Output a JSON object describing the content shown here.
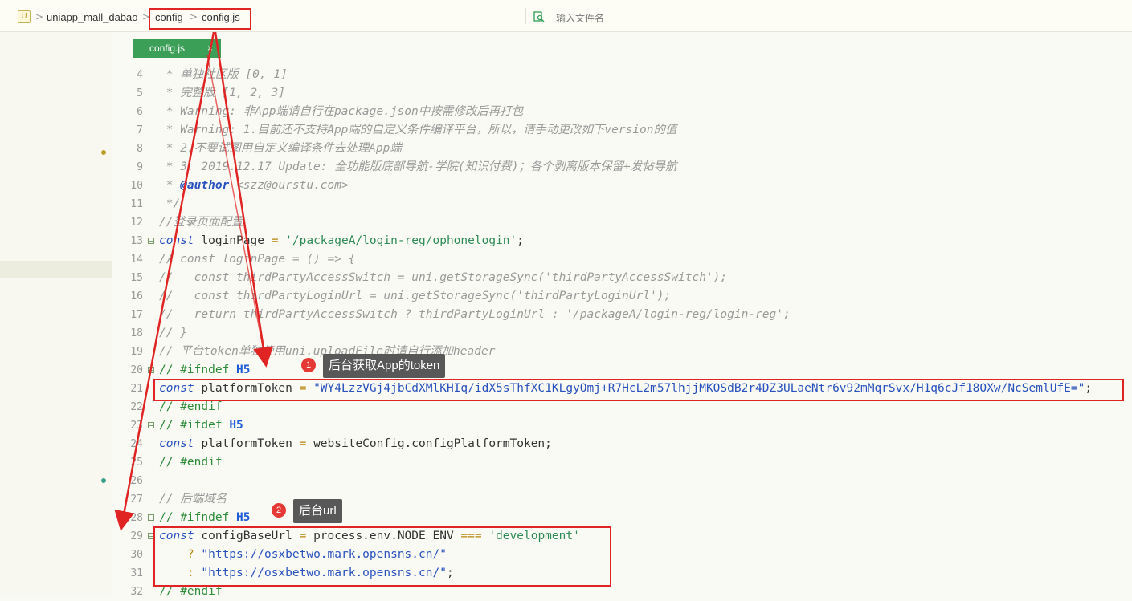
{
  "breadcrumb": {
    "logo": "U",
    "project": "uniapp_mall_dabao",
    "folder": "config",
    "file": "config.js",
    "separator": ">"
  },
  "find": {
    "placeholder": "输入文件名"
  },
  "tab": {
    "label": "config.js",
    "close": "×"
  },
  "lines": [
    {
      "n": "4",
      "parts": [
        {
          "c": "cm",
          "t": " * 单独社区版 [0, 1]"
        }
      ]
    },
    {
      "n": "5",
      "parts": [
        {
          "c": "cm",
          "t": " * 完整版 [1, 2, 3]"
        }
      ]
    },
    {
      "n": "6",
      "parts": [
        {
          "c": "cm",
          "t": " * Warning: 非App端请自行在package.json中按需修改后再打包"
        }
      ]
    },
    {
      "n": "7",
      "parts": [
        {
          "c": "cm",
          "t": " * Warning: 1.目前还不支持App端的自定义条件编译平台，所以，请手动更改如下version的值"
        }
      ]
    },
    {
      "n": "8",
      "parts": [
        {
          "c": "cm",
          "t": " * 2.不要试图用自定义编译条件去处理App端"
        }
      ]
    },
    {
      "n": "9",
      "parts": [
        {
          "c": "cm",
          "t": " * 3. 2019.12.17 Update: 全功能版底部导航-学院(知识付费)；各个剥离版本保留+发帖导航"
        }
      ]
    },
    {
      "n": "10",
      "parts": [
        {
          "c": "cm",
          "t": " * "
        },
        {
          "c": "tag-kw",
          "t": "@author"
        },
        {
          "c": "cm",
          "t": " <szz@ourstu.com>"
        }
      ]
    },
    {
      "n": "11",
      "parts": [
        {
          "c": "cm",
          "t": " */"
        }
      ]
    },
    {
      "n": "12",
      "parts": [
        {
          "c": "cm",
          "t": "//登录页面配置"
        }
      ]
    },
    {
      "n": "13",
      "fold": "⊟",
      "parts": [
        {
          "c": "kw",
          "t": "const"
        },
        {
          "c": "id",
          "t": " loginPage "
        },
        {
          "c": "op",
          "t": "="
        },
        {
          "c": "id",
          "t": " "
        },
        {
          "c": "str",
          "t": "'/packageA/login-reg/ophonelogin'"
        },
        {
          "c": "id",
          "t": ";"
        }
      ]
    },
    {
      "n": "14",
      "parts": [
        {
          "c": "cm",
          "t": "// const loginPage = () => {"
        }
      ]
    },
    {
      "n": "15",
      "parts": [
        {
          "c": "cm",
          "t": "//   const thirdPartyAccessSwitch = uni.getStorageSync('thirdPartyAccessSwitch');"
        }
      ]
    },
    {
      "n": "16",
      "parts": [
        {
          "c": "cm",
          "t": "//   const thirdPartyLoginUrl = uni.getStorageSync('thirdPartyLoginUrl');"
        }
      ]
    },
    {
      "n": "17",
      "parts": [
        {
          "c": "cm",
          "t": "//   return thirdPartyAccessSwitch ? thirdPartyLoginUrl : '/packageA/login-reg/login-reg';"
        }
      ]
    },
    {
      "n": "18",
      "parts": [
        {
          "c": "cm",
          "t": "// }"
        }
      ]
    },
    {
      "n": "19",
      "parts": [
        {
          "c": "cm",
          "t": "// 平台token单独使用uni.uploadFile时请自行添加header"
        }
      ]
    },
    {
      "n": "20",
      "fold": "⊟",
      "parts": [
        {
          "c": "dir",
          "t": "// #ifndef "
        },
        {
          "c": "macro",
          "t": "H5"
        }
      ]
    },
    {
      "n": "21",
      "parts": [
        {
          "c": "kw",
          "t": "const"
        },
        {
          "c": "id",
          "t": " platformToken "
        },
        {
          "c": "op",
          "t": "="
        },
        {
          "c": "id",
          "t": " "
        },
        {
          "c": "str2",
          "t": "\"WY4LzzVGj4jbCdXMlKHIq/idX5sThfXC1KLgyOmj+R7HcL2m57lhjjMKOSdB2r4DZ3ULaeNtr6v92mMqrSvx/H1q6cJf18OXw/NcSemlUfE=\""
        },
        {
          "c": "id",
          "t": ";"
        }
      ]
    },
    {
      "n": "22",
      "parts": [
        {
          "c": "dir",
          "t": "// #endif"
        }
      ]
    },
    {
      "n": "23",
      "fold": "⊟",
      "parts": [
        {
          "c": "dir",
          "t": "// #ifdef "
        },
        {
          "c": "macro",
          "t": "H5"
        }
      ]
    },
    {
      "n": "24",
      "parts": [
        {
          "c": "kw",
          "t": "const"
        },
        {
          "c": "id",
          "t": " platformToken "
        },
        {
          "c": "op",
          "t": "="
        },
        {
          "c": "id",
          "t": " websiteConfig.configPlatformToken;"
        }
      ]
    },
    {
      "n": "25",
      "parts": [
        {
          "c": "dir",
          "t": "// #endif"
        }
      ]
    },
    {
      "n": "26",
      "parts": []
    },
    {
      "n": "27",
      "parts": [
        {
          "c": "cm",
          "t": "// 后端域名"
        }
      ]
    },
    {
      "n": "28",
      "fold": "⊟",
      "parts": [
        {
          "c": "dir",
          "t": "// #ifndef "
        },
        {
          "c": "macro",
          "t": "H5"
        }
      ]
    },
    {
      "n": "29",
      "fold": "⊟",
      "parts": [
        {
          "c": "kw",
          "t": "const"
        },
        {
          "c": "id",
          "t": " configBaseUrl "
        },
        {
          "c": "op",
          "t": "="
        },
        {
          "c": "id",
          "t": " process.env.NODE_ENV "
        },
        {
          "c": "op",
          "t": "==="
        },
        {
          "c": "id",
          "t": " "
        },
        {
          "c": "str",
          "t": "'development'"
        }
      ]
    },
    {
      "n": "30",
      "parts": [
        {
          "c": "id",
          "t": "    "
        },
        {
          "c": "op",
          "t": "?"
        },
        {
          "c": "id",
          "t": " "
        },
        {
          "c": "str2",
          "t": "\"https://osxbetwo.mark.opensns.cn/\""
        }
      ]
    },
    {
      "n": "31",
      "parts": [
        {
          "c": "id",
          "t": "    "
        },
        {
          "c": "op",
          "t": ":"
        },
        {
          "c": "id",
          "t": " "
        },
        {
          "c": "str2",
          "t": "\"https://osxbetwo.mark.opensns.cn/\""
        },
        {
          "c": "id",
          "t": ";"
        }
      ]
    },
    {
      "n": "32",
      "parts": [
        {
          "c": "dir",
          "t": "// #endif"
        }
      ]
    }
  ],
  "callouts": [
    {
      "num": "1",
      "text": "后台获取App的token"
    },
    {
      "num": "2",
      "text": "后台url"
    }
  ],
  "colors": {
    "annotation": "#e02424",
    "tab": "#3c9f58",
    "callout": "#585858",
    "badge": "#e53935"
  }
}
